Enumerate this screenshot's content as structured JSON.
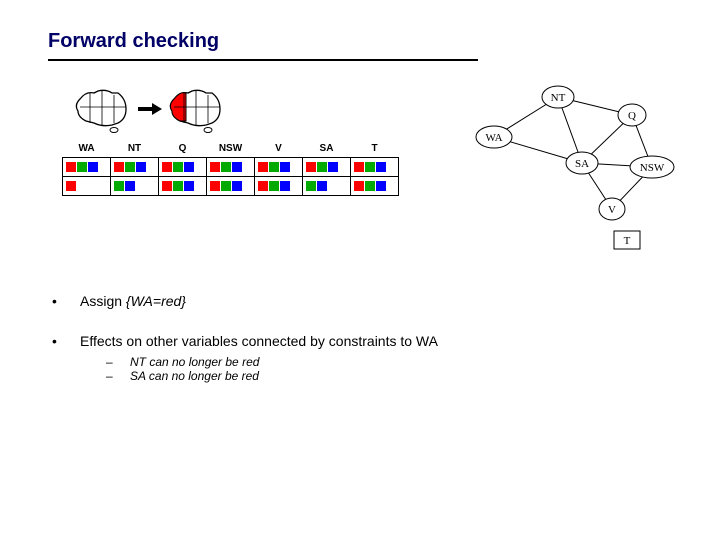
{
  "title": "Forward checking",
  "regions": [
    "WA",
    "NT",
    "Q",
    "NSW",
    "V",
    "SA",
    "T"
  ],
  "graph_nodes": [
    "NT",
    "WA",
    "Q",
    "SA",
    "NSW",
    "V",
    "T"
  ],
  "domains_initial": {
    "WA": [
      "r",
      "g",
      "b"
    ],
    "NT": [
      "r",
      "g",
      "b"
    ],
    "Q": [
      "r",
      "g",
      "b"
    ],
    "NSW": [
      "r",
      "g",
      "b"
    ],
    "V": [
      "r",
      "g",
      "b"
    ],
    "SA": [
      "r",
      "g",
      "b"
    ],
    "T": [
      "r",
      "g",
      "b"
    ]
  },
  "domains_after": {
    "WA": [
      "r"
    ],
    "NT": [
      "g",
      "b"
    ],
    "Q": [
      "r",
      "g",
      "b"
    ],
    "NSW": [
      "r",
      "g",
      "b"
    ],
    "V": [
      "r",
      "g",
      "b"
    ],
    "SA": [
      "g",
      "b"
    ],
    "T": [
      "r",
      "g",
      "b"
    ]
  },
  "wa_assigned_color": "red",
  "bullets": {
    "assign_prefix": "Assign ",
    "assign_value": "{WA=red}",
    "effects": "Effects on other variables connected by constraints to WA",
    "sub1": "NT can no longer be red",
    "sub2": "SA can no longer be red"
  }
}
